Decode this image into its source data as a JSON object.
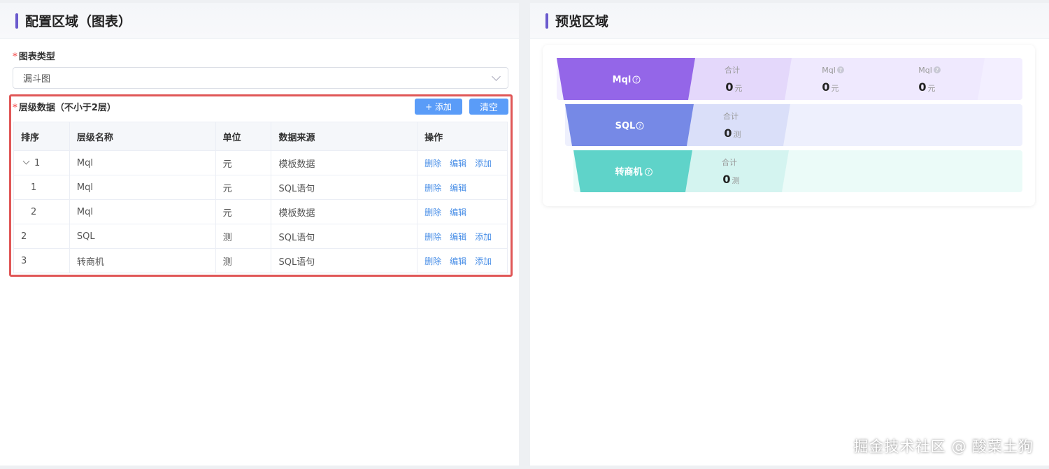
{
  "left_panel": {
    "title": "配置区域（图表）",
    "chart_type_label": "图表类型",
    "chart_type_value": "漏斗图",
    "levels_label": "层级数据（不小于2层）",
    "add_button": "+ 添加",
    "clear_button": "清空",
    "table": {
      "headers": [
        "排序",
        "层级名称",
        "单位",
        "数据来源",
        "操作"
      ],
      "rows": [
        {
          "order": "1",
          "name": "Mql",
          "unit": "元",
          "source": "模板数据",
          "ops": [
            "删除",
            "编辑",
            "添加"
          ]
        },
        {
          "order": "1",
          "name": "Mql",
          "unit": "元",
          "source": "SQL语句",
          "ops": [
            "删除",
            "编辑"
          ]
        },
        {
          "order": "2",
          "name": "Mql",
          "unit": "元",
          "source": "模板数据",
          "ops": [
            "删除",
            "编辑"
          ]
        },
        {
          "order": "2",
          "name": "SQL",
          "unit": "测",
          "source": "SQL语句",
          "ops": [
            "删除",
            "编辑",
            "添加"
          ]
        },
        {
          "order": "3",
          "name": "转商机",
          "unit": "测",
          "source": "SQL语句",
          "ops": [
            "删除",
            "编辑",
            "添加"
          ]
        }
      ]
    }
  },
  "right_panel": {
    "title": "预览区域",
    "funnel": [
      {
        "label": "Mql",
        "color": "#9466e8",
        "bg": "#f3efff",
        "stats": [
          {
            "title": "合计",
            "value": "0",
            "unit": "元"
          },
          {
            "title": "Mql",
            "value": "0",
            "unit": "元"
          },
          {
            "title": "Mql",
            "value": "0",
            "unit": "元"
          }
        ]
      },
      {
        "label": "SQL",
        "color": "#7689e6",
        "bg": "#eef0fd",
        "stats": [
          {
            "title": "合计",
            "value": "0",
            "unit": "测"
          }
        ]
      },
      {
        "label": "转商机",
        "color": "#5fd3c9",
        "bg": "#ebfbf8",
        "stats": [
          {
            "title": "合计",
            "value": "0",
            "unit": "测"
          }
        ]
      }
    ]
  },
  "watermark": "掘金技术社区 @ 酸菜土狗"
}
